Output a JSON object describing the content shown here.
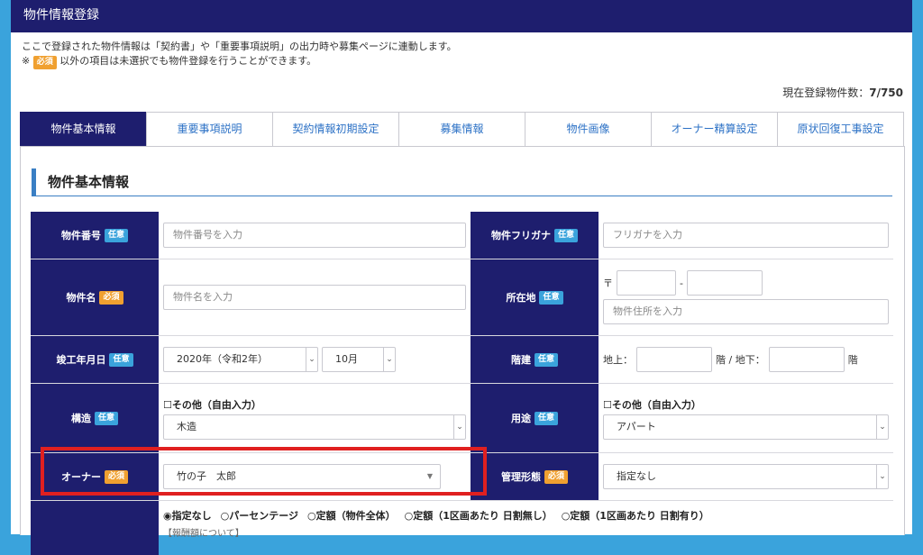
{
  "header": {
    "title": "物件情報登録"
  },
  "notice": {
    "line1": "ここで登録された物件情報は「契約書」や「重要事項説明」の出力時や募集ページに連動します。",
    "line2_prefix": "※",
    "line2_badge": "必須",
    "line2_suffix": "以外の項目は未選択でも物件登録を行うことができます。"
  },
  "count": {
    "label": "現在登録物件数：",
    "value": "7/750"
  },
  "tabs": [
    {
      "label": "物件基本情報"
    },
    {
      "label": "重要事項説明"
    },
    {
      "label": "契約情報初期設定"
    },
    {
      "label": "募集情報"
    },
    {
      "label": "物件画像"
    },
    {
      "label": "オーナー精算設定"
    },
    {
      "label": "原状回復工事設定"
    }
  ],
  "section": {
    "title": "物件基本情報"
  },
  "badges": {
    "optional": "任意",
    "required": "必須"
  },
  "fields": {
    "property_no": {
      "label": "物件番号",
      "placeholder": "物件番号を入力"
    },
    "furigana": {
      "label": "物件フリガナ",
      "placeholder": "フリガナを入力"
    },
    "name": {
      "label": "物件名",
      "placeholder": "物件名を入力"
    },
    "address": {
      "label": "所在地",
      "postal_mark": "〒",
      "dash": "-",
      "placeholder": "物件住所を入力"
    },
    "built": {
      "label": "竣工年月日",
      "year": "2020年（令和2年）",
      "month": "10月"
    },
    "floors": {
      "label": "階建",
      "above": "地上：",
      "below_sep": "階 / 地下：",
      "unit": "階"
    },
    "structure": {
      "label": "構造",
      "check": "☐その他（自由入力）",
      "value": "木造"
    },
    "usage": {
      "label": "用途",
      "check": "☐その他（自由入力）",
      "value": "アパート"
    },
    "owner": {
      "label": "オーナー",
      "value": "竹の子　太郎"
    },
    "management": {
      "label": "管理形態",
      "value": "指定なし"
    }
  },
  "fee": {
    "options": [
      "◉指定なし",
      "○パーセンテージ",
      "○定額（物件全体）",
      "○定額（1区画あたり 日割無し）",
      "○定額（1区画あたり 日割有り）"
    ],
    "note": "【報酬額について】"
  }
}
